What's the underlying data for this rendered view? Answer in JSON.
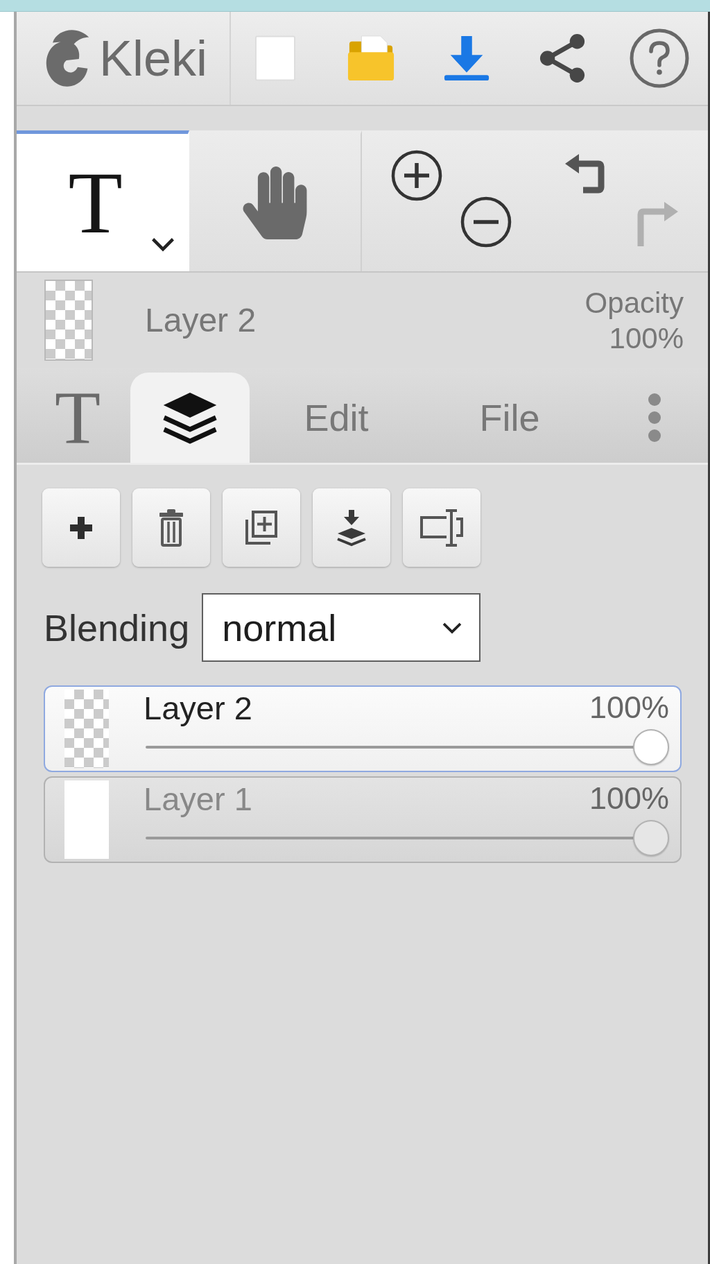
{
  "logo": {
    "text": "Kleki"
  },
  "tools": [
    {
      "kind": "text",
      "glyph": "T",
      "selected": true
    },
    {
      "kind": "hand",
      "selected": false
    }
  ],
  "undo": {
    "disabled": false
  },
  "redo": {
    "disabled": true
  },
  "current_layer": {
    "transparent": true,
    "name": "Layer 2",
    "opacity_label": "Opacity",
    "opacity_value": "100%"
  },
  "tabs": [
    {
      "kind": "glyph",
      "label": "T",
      "selected": false
    },
    {
      "kind": "icon",
      "selected": true
    },
    {
      "kind": "label",
      "label": "Edit",
      "selected": false
    },
    {
      "kind": "label",
      "label": "File",
      "selected": false
    }
  ],
  "blending": {
    "label": "Blending",
    "value": "normal"
  },
  "layers": [
    {
      "name": "Layer 2",
      "opacity": "100%",
      "level": 1,
      "selected": true,
      "transparent": true
    },
    {
      "name": "Layer 1",
      "opacity": "100%",
      "level": 1,
      "selected": false,
      "transparent": false
    }
  ]
}
